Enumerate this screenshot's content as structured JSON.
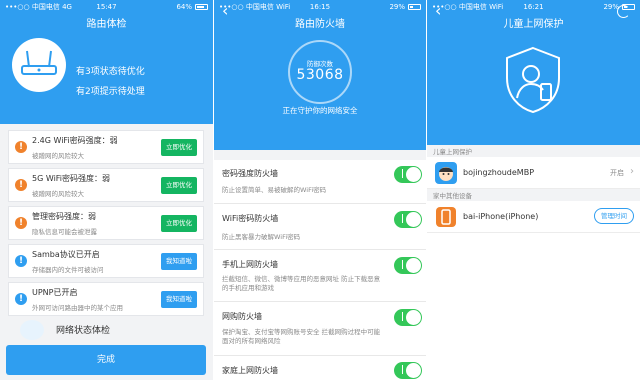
{
  "status_bar": {
    "carrier": "•••○○ 中国电信",
    "network_p1": "4G",
    "network_wifi": "WiFi",
    "time_p1": "15:47",
    "time_p2": "16:15",
    "time_p3": "16:21",
    "battery_p1": "64%",
    "battery_p2": "29%",
    "battery_p3": "29%",
    "battery_p1_level": 0.64,
    "battery_p2_level": 0.29
  },
  "screen1": {
    "title": "路由体检",
    "summary_line1": "有3项状态待优化",
    "summary_line2": "有2项提示待处理",
    "items": [
      {
        "title": "2.4G WiFi密码强度：弱",
        "desc": "被蹭网的风险较大",
        "action": "立即优化",
        "level": "warn"
      },
      {
        "title": "5G WiFi密码强度：弱",
        "desc": "被蹭网的风险较大",
        "action": "立即优化",
        "level": "warn"
      },
      {
        "title": "管理密码强度：弱",
        "desc": "隐私信息可能会被泄露",
        "action": "立即优化",
        "level": "warn"
      },
      {
        "title": "Samba协议已开启",
        "desc": "存储器内的文件可被访问",
        "action": "我知道啦",
        "level": "info"
      },
      {
        "title": "UPNP已开启",
        "desc": "外网可访问路由器中的某个应用",
        "action": "我知道啦",
        "level": "info"
      }
    ],
    "net_check": "网络状态体检",
    "done": "完成"
  },
  "screen2": {
    "title": "路由防火墙",
    "counter_label": "防御次数",
    "counter_value": "53068",
    "guard_text": "正在守护你的网络安全",
    "rows": [
      {
        "title": "密码强度防火墙",
        "desc": "防止设置简单、易被破解的WiFi密码"
      },
      {
        "title": "WiFi密码防火墙",
        "desc": "防止黑客暴力破解WiFi密码"
      },
      {
        "title": "手机上网防火墙",
        "desc": "拦截短信、微信、微博等应用的恶意网址 防止下载恶意的手机应用和游戏"
      },
      {
        "title": "网购防火墙",
        "desc": "保护淘宝、支付宝等网购账号安全 拦截网购过程中可能面对的所有网络风险"
      },
      {
        "title": "家庭上网防火墙",
        "desc": ""
      }
    ]
  },
  "screen3": {
    "title": "儿童上网保护",
    "section_child": "儿童上网保护",
    "section_family": "家中其他设备",
    "child_device": {
      "name": "bojingzhoudeMBP",
      "status": "开启"
    },
    "family_device": {
      "name": "bai-iPhone(iPhone)",
      "action": "管理时间"
    }
  },
  "colors": {
    "primary": "#2f9ef0",
    "green": "#14b561",
    "orange": "#f0822c",
    "toggle": "#34c759"
  }
}
